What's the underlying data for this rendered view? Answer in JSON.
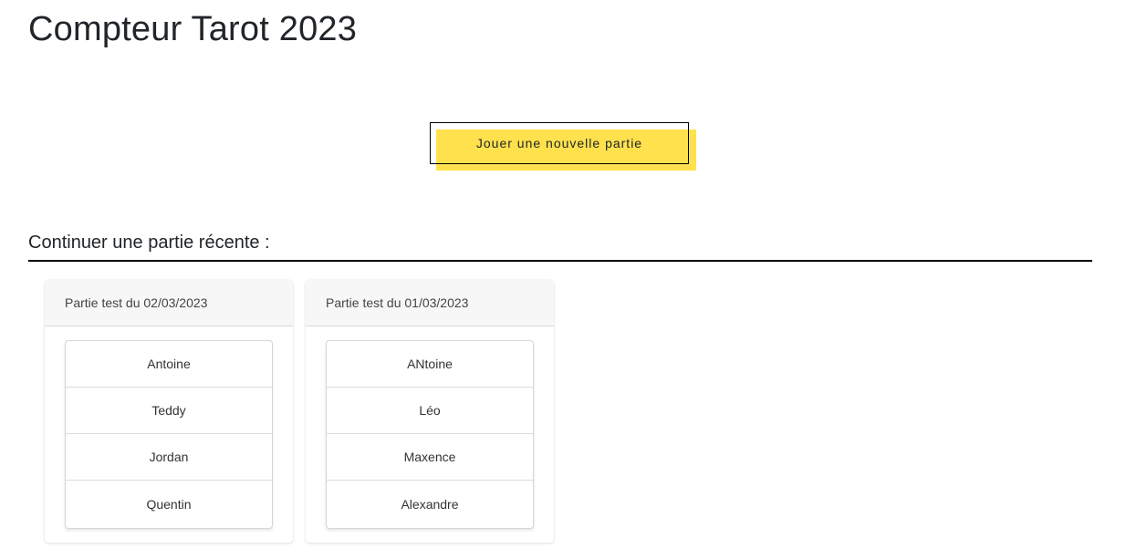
{
  "header": {
    "title": "Compteur Tarot 2023"
  },
  "actions": {
    "new_game_label": "Jouer une nouvelle partie"
  },
  "recent": {
    "title": "Continuer une partie récente :",
    "games": [
      {
        "title": "Partie test du 02/03/2023",
        "players": [
          "Antoine",
          "Teddy",
          "Jordan",
          "Quentin"
        ]
      },
      {
        "title": "Partie test du 01/03/2023",
        "players": [
          "ANtoine",
          "Léo",
          "Maxence",
          "Alexandre"
        ]
      }
    ]
  },
  "colors": {
    "accent": "#ffe14d",
    "text": "#212529",
    "rule": "#000000"
  }
}
